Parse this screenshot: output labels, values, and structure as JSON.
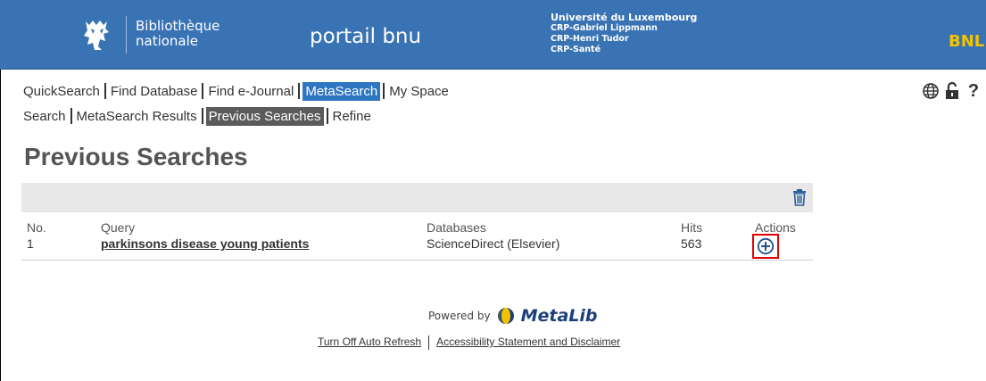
{
  "header": {
    "library_line1": "Bibliothèque",
    "library_line2": "nationale",
    "portal_title": "portail bnu",
    "partners": [
      "Université du Luxembourg",
      "CRP-Gabriel Lippmann",
      "CRP-Henri Tudor",
      "CRP-Santé"
    ],
    "brand_short": "BNL",
    "colors": {
      "bar": "#3a73b4",
      "brand_short": "#f5c300"
    }
  },
  "nav": {
    "main": [
      {
        "label": "QuickSearch",
        "active": false
      },
      {
        "label": "Find Database",
        "active": false
      },
      {
        "label": "Find e-Journal",
        "active": false
      },
      {
        "label": "MetaSearch",
        "active": true
      },
      {
        "label": "My Space",
        "active": false
      }
    ],
    "sub": [
      {
        "label": "Search",
        "active": false
      },
      {
        "label": "MetaSearch Results",
        "active": false
      },
      {
        "label": "Previous Searches",
        "active": true
      },
      {
        "label": "Refine",
        "active": false
      }
    ],
    "icons": [
      "globe-icon",
      "lock-icon",
      "help-icon"
    ]
  },
  "page": {
    "title": "Previous Searches"
  },
  "table": {
    "columns": [
      "No.",
      "Query",
      "Databases",
      "Hits",
      "Actions"
    ],
    "rows": [
      {
        "no": "1",
        "query": "parkinsons disease young patients",
        "databases": "ScienceDirect (Elsevier)",
        "hits": "563",
        "action_icon": "add-circle-icon"
      }
    ],
    "toolbar_icon": "trash-icon"
  },
  "footer": {
    "powered_by": "Powered by",
    "product": "MetaLib",
    "links": [
      "Turn Off Auto Refresh",
      "Accessibility Statement and Disclaimer"
    ]
  }
}
